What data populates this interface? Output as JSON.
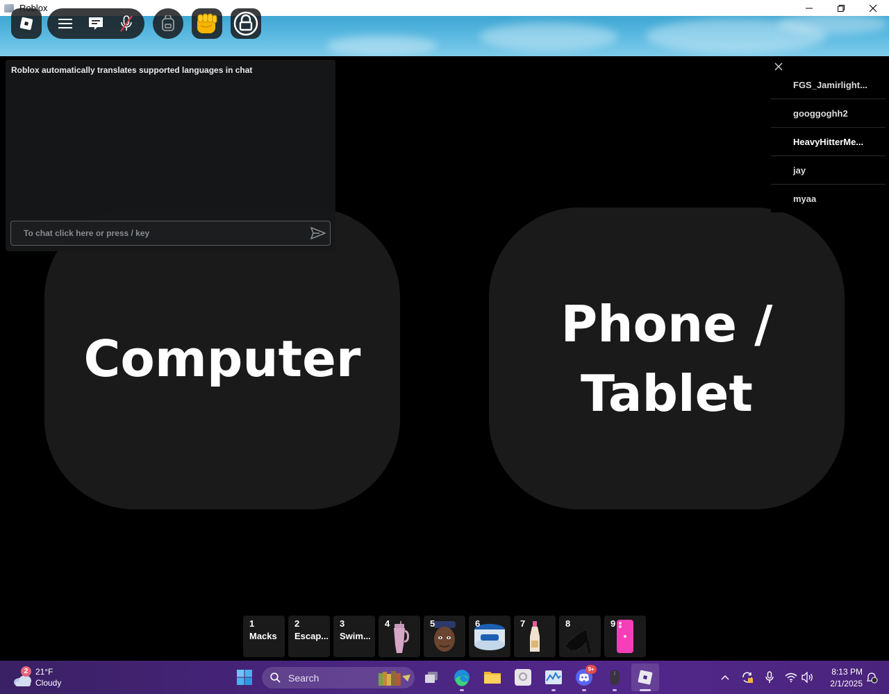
{
  "window": {
    "title": "Roblox"
  },
  "chat": {
    "system_message": "Roblox automatically translates supported languages in chat",
    "input_placeholder": "To chat click here or press / key"
  },
  "device_choice": {
    "left_label": "Computer",
    "right_label_line1": "Phone /",
    "right_label_line2": "Tablet"
  },
  "player_list": [
    "FGS_Jamirlight...",
    "googgoghh2",
    "HeavyHitterMe...",
    "jay",
    "myaa"
  ],
  "hotbar": [
    {
      "num": "1",
      "label": "Macks"
    },
    {
      "num": "2",
      "label": "Escap..."
    },
    {
      "num": "3",
      "label": "Swim..."
    },
    {
      "num": "4",
      "label": "",
      "icon": "pink-tumbler-icon"
    },
    {
      "num": "5",
      "label": "",
      "icon": "face-sticker-icon"
    },
    {
      "num": "6",
      "label": "",
      "icon": "vaseline-jar-icon"
    },
    {
      "num": "7",
      "label": "",
      "icon": "perfume-bottle-icon"
    },
    {
      "num": "8",
      "label": "",
      "icon": "black-heels-icon"
    },
    {
      "num": "9",
      "label": "",
      "icon": "pink-phone-icon"
    }
  ],
  "taskbar": {
    "weather_badge": "2",
    "temperature": "21°F",
    "condition": "Cloudy",
    "search_label": "Search",
    "discord_badge": "9+",
    "time": "8:13 PM",
    "date": "2/1/2025"
  },
  "colors": {
    "taskbar": "#4a2581",
    "panel": "#1a1a1a",
    "sky": "#58b8e0"
  }
}
